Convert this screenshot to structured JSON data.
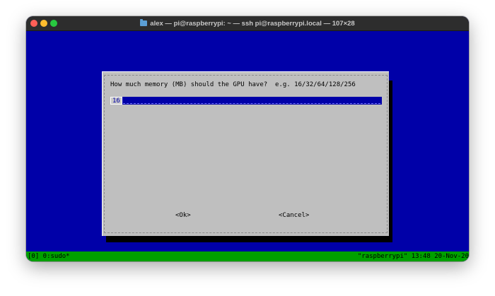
{
  "window": {
    "title": "alex — pi@raspberrypi: ~ — ssh pi@raspberrypi.local — 107×28",
    "title_icon": "folder-icon"
  },
  "dialog": {
    "prompt": "How much memory (MB) should the GPU have?  e.g. 16/32/64/128/256",
    "input_value": "16",
    "ok_label": "<Ok>",
    "cancel_label": "<Cancel>"
  },
  "statusbar": {
    "left": "[0] 0:sudo*",
    "right": "\"raspberrypi\" 13:48 20-Nov-20"
  },
  "colors": {
    "terminal_bg": "#0000a8",
    "dialog_bg": "#bfbfbf",
    "status_bg": "#00a000",
    "titlebar_bg": "#2d2d2d"
  }
}
